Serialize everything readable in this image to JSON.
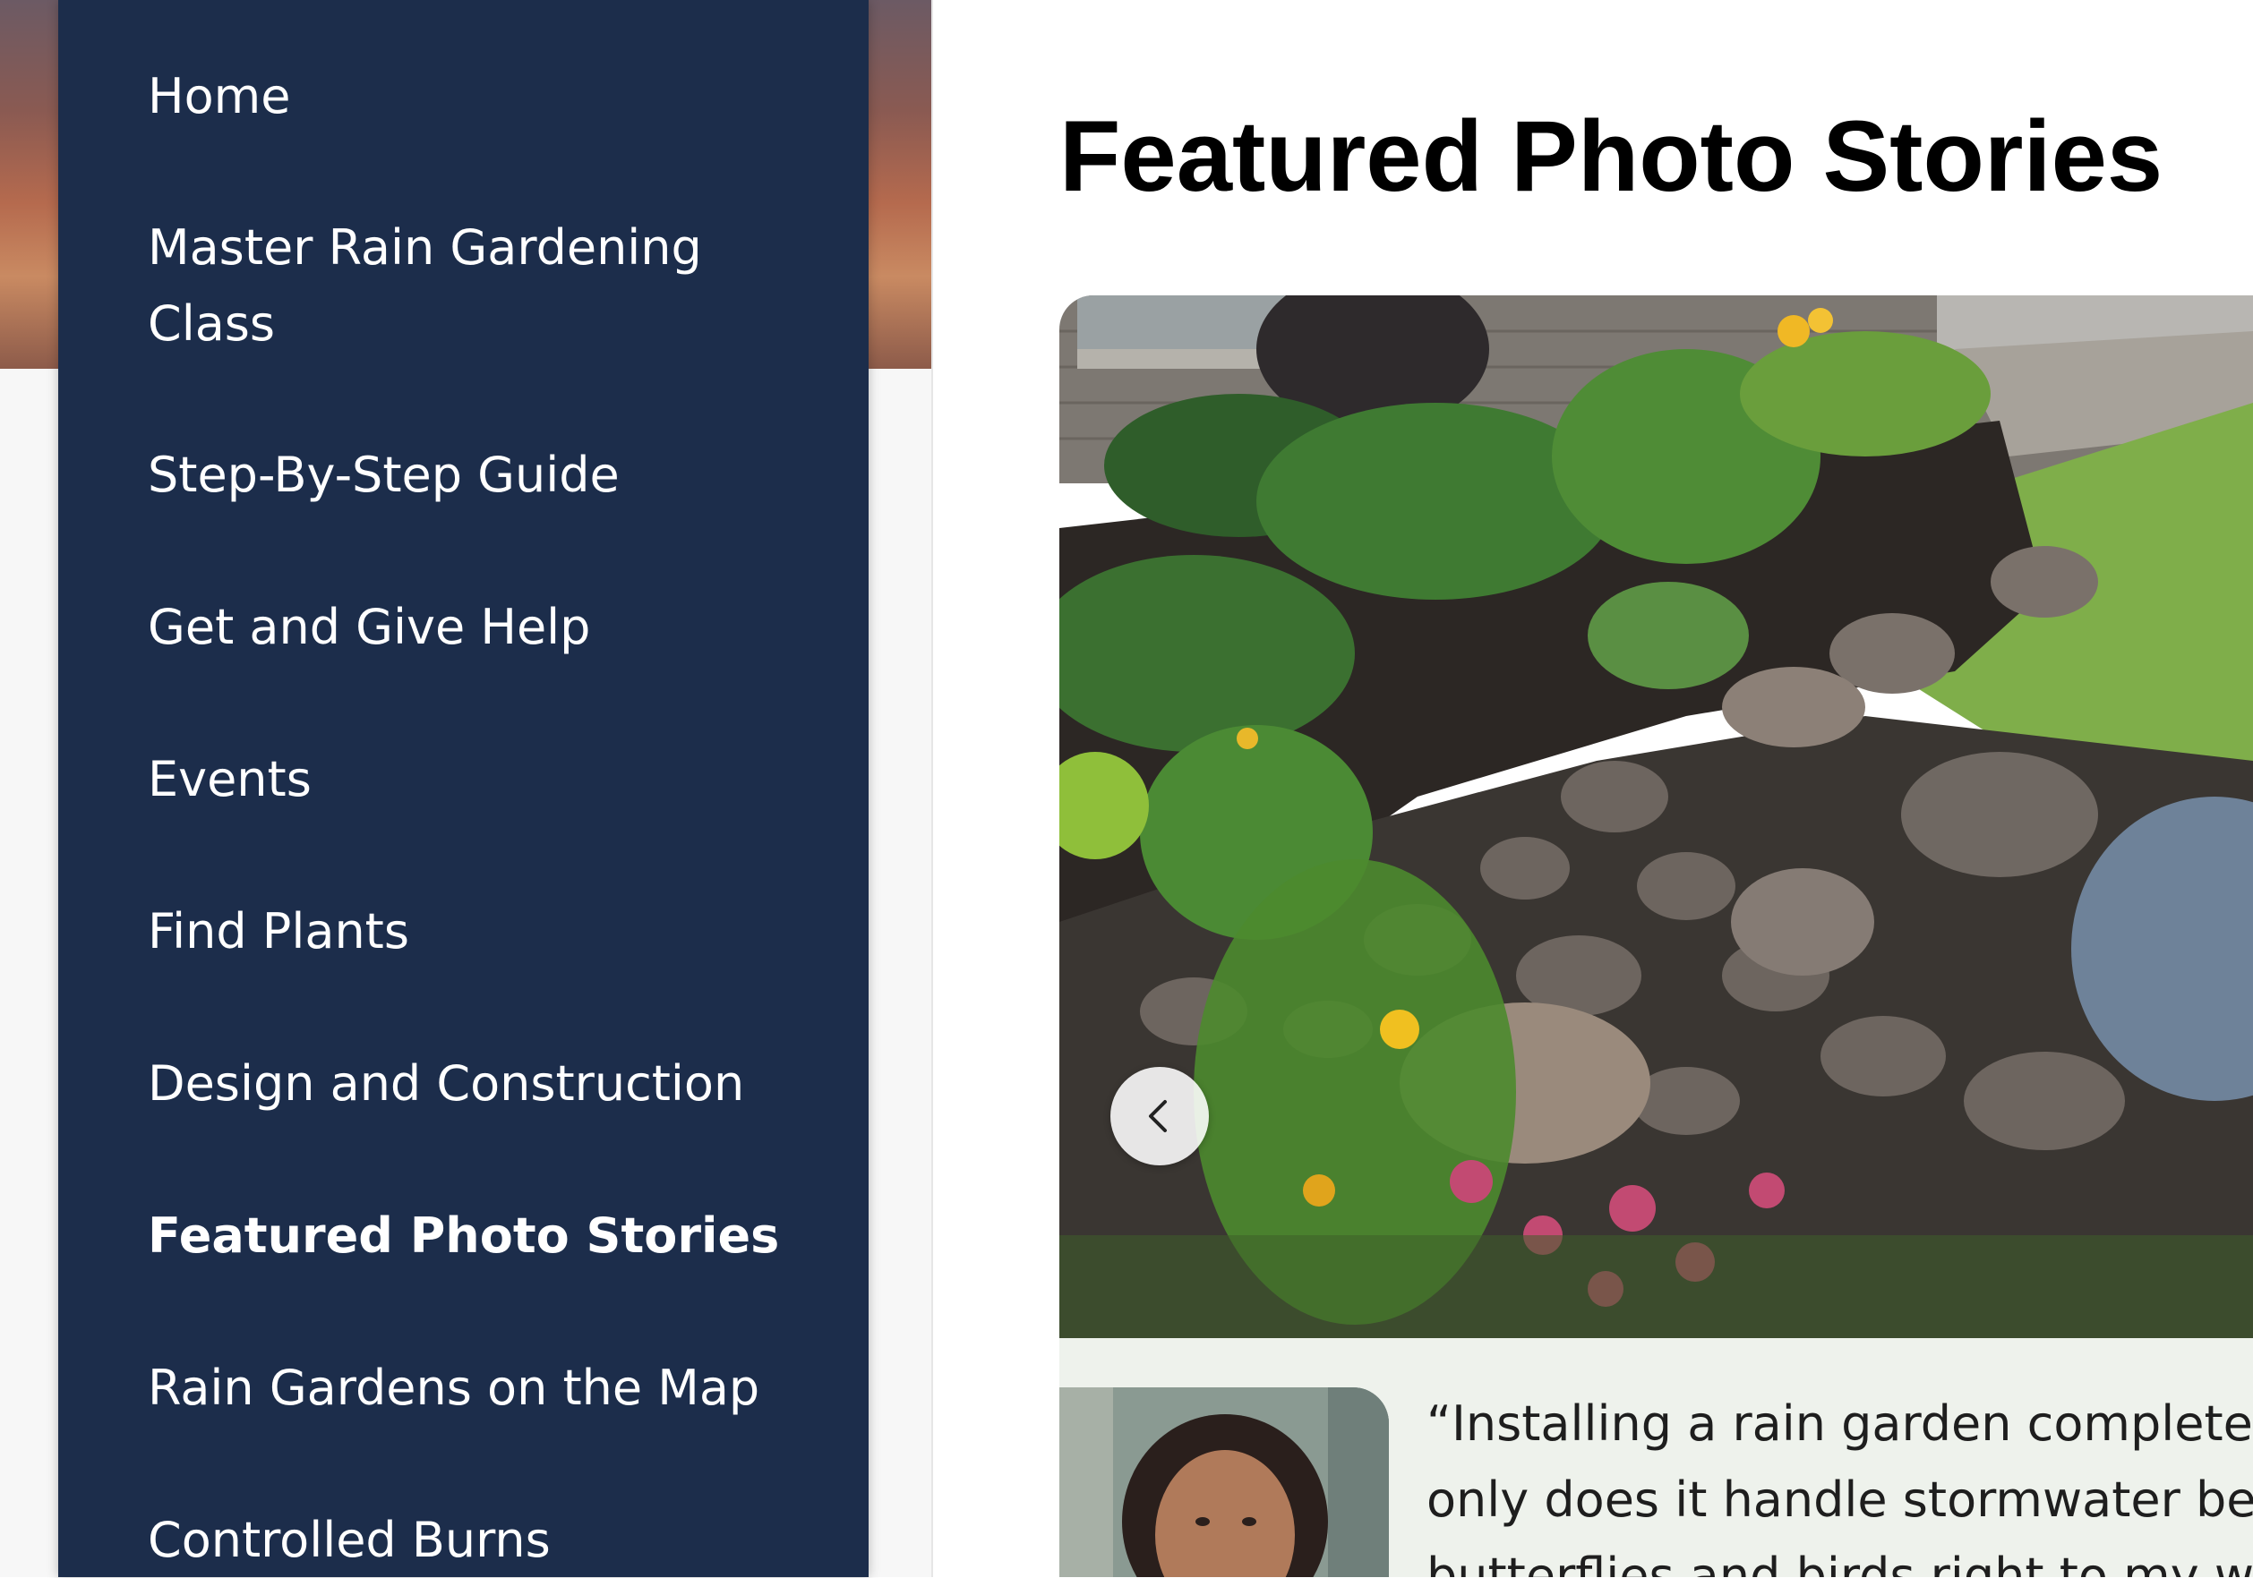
{
  "sidebar": {
    "items": [
      {
        "label": "Home",
        "active": false
      },
      {
        "label": "Master Rain Gardening\nClass",
        "active": false
      },
      {
        "label": "Step-By-Step Guide",
        "active": false
      },
      {
        "label": "Get and Give Help",
        "active": false
      },
      {
        "label": "Events",
        "active": false
      },
      {
        "label": "Find Plants",
        "active": false
      },
      {
        "label": "Design and Construction",
        "active": false
      },
      {
        "label": "Featured Photo Stories",
        "active": true
      },
      {
        "label": "Rain Gardens on the Map",
        "active": false
      },
      {
        "label": "Controlled Burns",
        "active": false
      }
    ]
  },
  "main": {
    "title": "Featured Photo Stories",
    "carousel": {
      "prev_icon": "chevron-left-icon",
      "quote_lines": [
        "“Installing a rain garden completely",
        "only does it handle stormwater bea",
        "butterflies and birds right to my wi"
      ]
    }
  },
  "colors": {
    "sidebar_bg": "#1c2d4b",
    "sidebar_text": "#ffffff",
    "title_text": "#000000"
  }
}
